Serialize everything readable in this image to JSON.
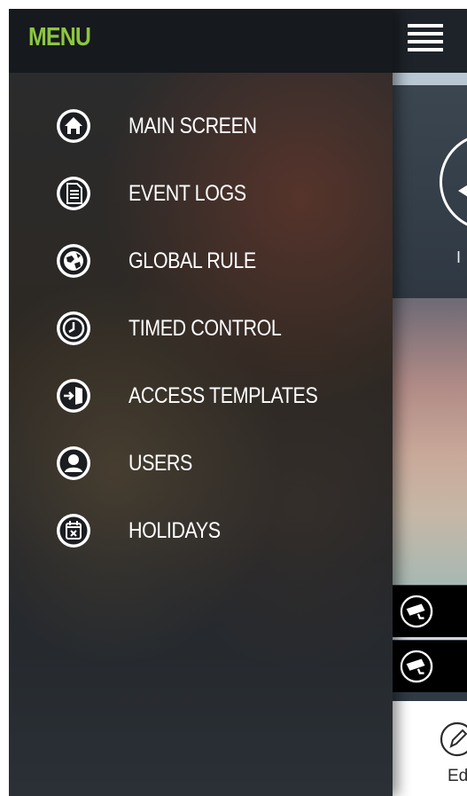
{
  "drawer": {
    "title": "MENU",
    "items": [
      {
        "label": "MAIN SCREEN",
        "icon": "home-icon"
      },
      {
        "label": "EVENT LOGS",
        "icon": "document-icon"
      },
      {
        "label": "GLOBAL RULE",
        "icon": "globe-icon"
      },
      {
        "label": "TIMED CONTROL",
        "icon": "clock-icon"
      },
      {
        "label": "ACCESS TEMPLATES",
        "icon": "door-enter-icon"
      },
      {
        "label": "USERS",
        "icon": "user-icon"
      },
      {
        "label": "HOLIDAYS",
        "icon": "calendar-x-icon"
      }
    ]
  },
  "app": {
    "hero_label": "I",
    "bottom_action_label": "Edi"
  },
  "colors": {
    "accent": "#8cc63f",
    "header_bg": "#16191d",
    "menu_text": "#ffffff"
  }
}
